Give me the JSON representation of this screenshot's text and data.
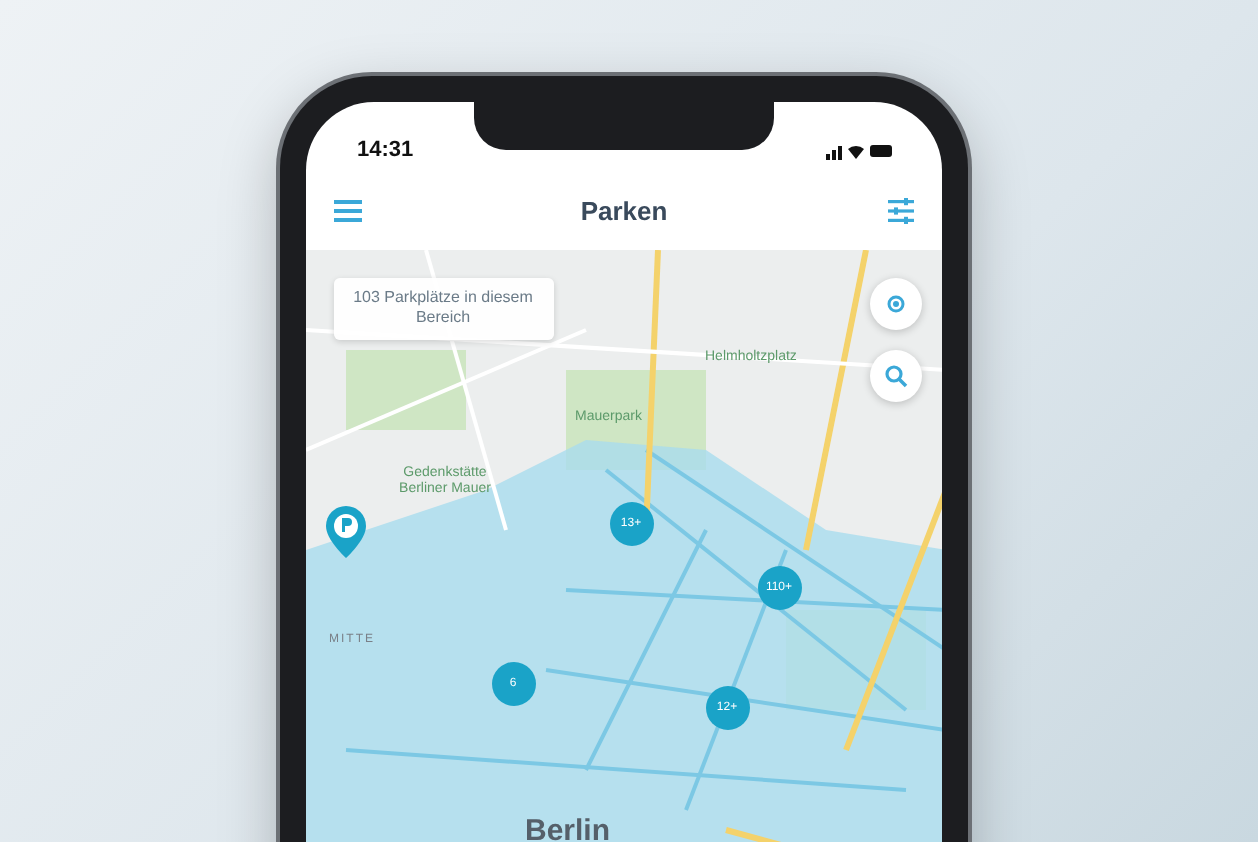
{
  "status_bar": {
    "time": "14:31"
  },
  "nav_bar": {
    "title": "Parken"
  },
  "map": {
    "info_bubble": "103 Parkplätze in diesem Bereich",
    "labels": [
      {
        "text": "Helmholtzplatz",
        "kind": "place"
      },
      {
        "text": "Mauerpark",
        "kind": "place"
      },
      {
        "text": "Gedenkstätte Berliner Mauer",
        "kind": "place"
      },
      {
        "text": "MITTE",
        "kind": "district"
      },
      {
        "text": "Berlin",
        "kind": "city"
      }
    ],
    "clusters": [
      {
        "label": "13+"
      },
      {
        "label": "110+"
      },
      {
        "label": "6"
      },
      {
        "label": "12+"
      }
    ]
  }
}
